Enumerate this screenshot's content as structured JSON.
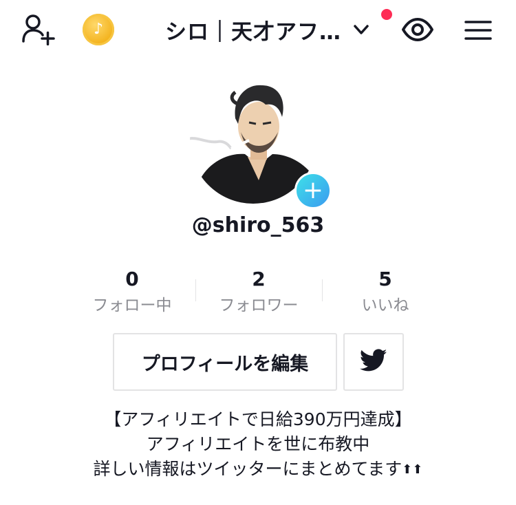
{
  "header": {
    "title": "シロ｜天才アフ…",
    "icons": [
      "add-user-icon",
      "coin-icon",
      "chevron-down-icon",
      "eye-icon",
      "menu-icon"
    ],
    "notification_dot_color": "#fe2c55"
  },
  "profile": {
    "username": "@shiro_563",
    "avatar_plus": "+"
  },
  "stats": [
    {
      "value": "0",
      "label": "フォロー中"
    },
    {
      "value": "2",
      "label": "フォロワー"
    },
    {
      "value": "5",
      "label": "いいね"
    }
  ],
  "actions": {
    "edit_label": "プロフィールを編集",
    "twitter_icon": "twitter-icon"
  },
  "bio": {
    "line1": "【アフィリエイトで日給390万円達成】",
    "line2": "アフィリエイトを世に布教中",
    "line3": "詳しい情報はツイッターにまとめてます",
    "line3_suffix": "⬆⬆"
  },
  "colors": {
    "text": "#161823",
    "muted": "#8a8b91",
    "border": "#e3e3e4",
    "plus_gradient_start": "#3ee0e8",
    "plus_gradient_end": "#3b9bf0",
    "coin": "#f3b21c"
  }
}
